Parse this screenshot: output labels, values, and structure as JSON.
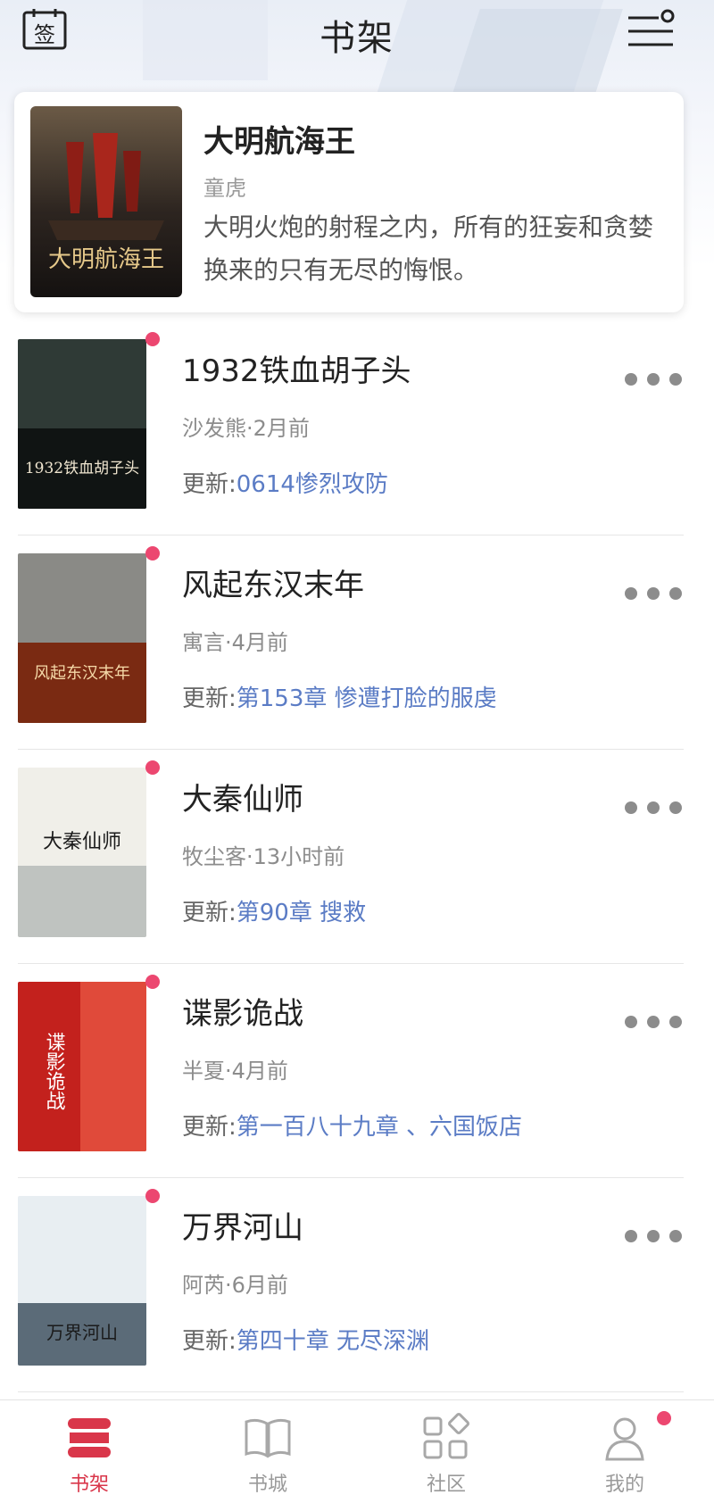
{
  "header": {
    "title": "书架",
    "sign_icon_text": "签"
  },
  "featured": {
    "title": "大明航海王",
    "author": "童虎",
    "description": "大明火炮的射程之内，所有的狂妄和贪婪换来的只有无尽的悔恨。",
    "cover_text": "大明航海王"
  },
  "books": [
    {
      "title": "1932铁血胡子头",
      "meta": "沙发熊·2月前",
      "update_prefix": "更新:",
      "update_chapter": "0614惨烈攻防",
      "cover_text": "1932铁血胡子头",
      "cover_colors": [
        "#2f3a36",
        "#5a4a3a",
        "#101413"
      ]
    },
    {
      "title": "风起东汉末年",
      "meta": "寓言·4月前",
      "update_prefix": "更新:",
      "update_chapter": "第153章  惨遭打脸的服虔",
      "cover_text": "风起东汉末年",
      "cover_colors": [
        "#8a8a86",
        "#3c3a36",
        "#7a2a12"
      ]
    },
    {
      "title": "大秦仙师",
      "meta": "牧尘客·13小时前",
      "update_prefix": "更新:",
      "update_chapter": "第90章 搜救",
      "cover_text": "大秦仙师",
      "cover_colors": [
        "#f0efe9",
        "#d9dad4",
        "#bfc3c0"
      ]
    },
    {
      "title": "谍影诡战",
      "meta": "半夏·4月前",
      "update_prefix": "更新:",
      "update_chapter": "第一百八十九章 、六国饭店",
      "cover_text": "谍影诡战",
      "cover_colors": [
        "#c3211d",
        "#8f1612",
        "#e04a3a"
      ]
    },
    {
      "title": "万界河山",
      "meta": "阿芮·6月前",
      "update_prefix": "更新:",
      "update_chapter": "第四十章   无尽深渊",
      "cover_text": "万界河山",
      "cover_colors": [
        "#e8eef2",
        "#a9b8c3",
        "#5b6b78"
      ]
    }
  ],
  "tabs": [
    {
      "label": "书架",
      "icon": "bookshelf-icon",
      "active": true
    },
    {
      "label": "书城",
      "icon": "open-book-icon",
      "active": false
    },
    {
      "label": "社区",
      "icon": "grid-shapes-icon",
      "active": false
    },
    {
      "label": "我的",
      "icon": "user-icon",
      "active": false,
      "badge": true
    }
  ],
  "colors": {
    "accent": "#d9364a",
    "dot": "#ec4770",
    "link": "#5b7cc5",
    "muted": "#8c8c8c"
  }
}
